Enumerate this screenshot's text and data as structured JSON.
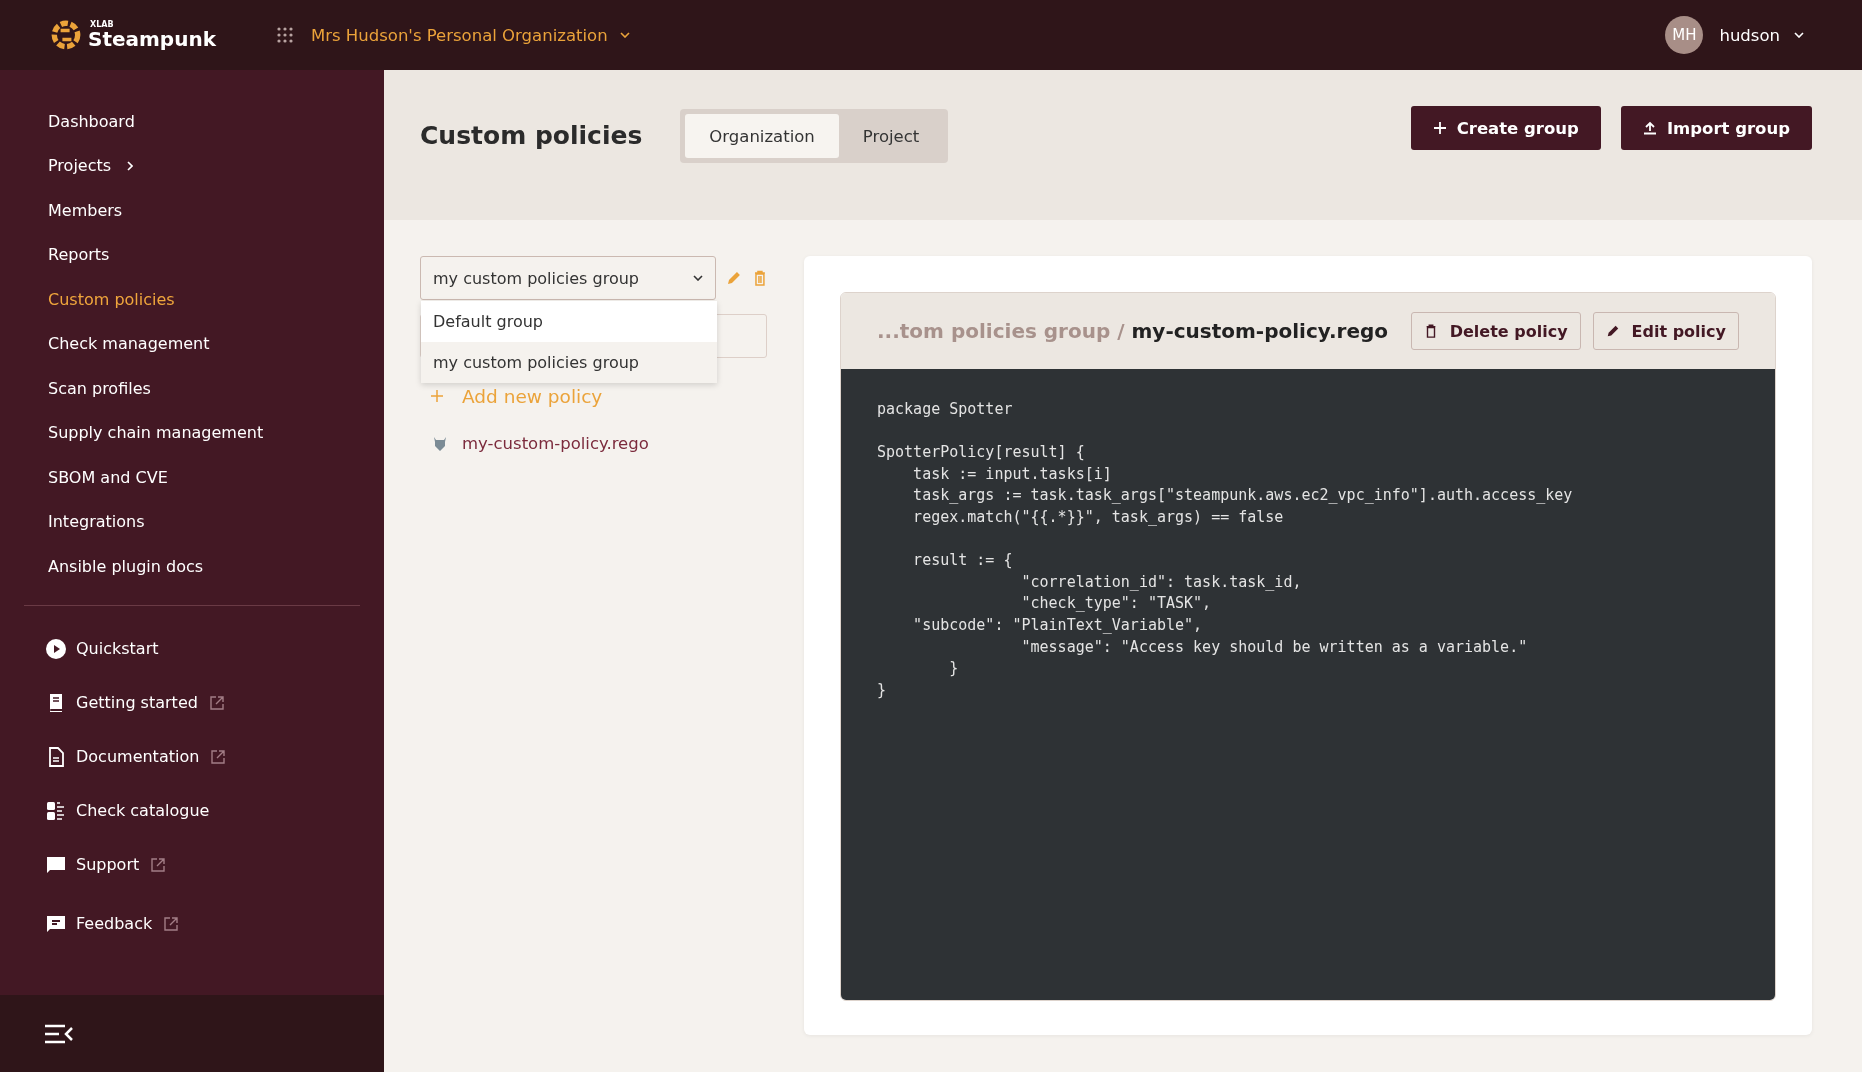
{
  "header": {
    "logo_small": "XLAB",
    "logo": "Steampunk",
    "organization": "Mrs Hudson's Personal Organization",
    "user": {
      "initials": "MH",
      "name": "hudson"
    }
  },
  "sidebar": {
    "items": [
      {
        "label": "Dashboard",
        "selected": false,
        "submenu": false
      },
      {
        "label": "Projects",
        "selected": false,
        "submenu": true
      },
      {
        "label": "Members",
        "selected": false,
        "submenu": false
      },
      {
        "label": "Reports",
        "selected": false,
        "submenu": false
      },
      {
        "label": "Custom policies",
        "selected": true,
        "submenu": false
      },
      {
        "label": "Check management",
        "selected": false,
        "submenu": false
      },
      {
        "label": "Scan profiles",
        "selected": false,
        "submenu": false
      },
      {
        "label": "Supply chain management",
        "selected": false,
        "submenu": false
      },
      {
        "label": "SBOM and CVE",
        "selected": false,
        "submenu": false
      },
      {
        "label": "Integrations",
        "selected": false,
        "submenu": false
      },
      {
        "label": "Ansible plugin docs",
        "selected": false,
        "submenu": false
      }
    ],
    "links": [
      {
        "label": "Quickstart",
        "kind": "play",
        "external": false
      },
      {
        "label": "Getting started",
        "kind": "book",
        "external": true
      },
      {
        "label": "Documentation",
        "kind": "document",
        "external": true
      },
      {
        "label": "Check catalogue",
        "kind": "catalogue",
        "external": false
      },
      {
        "label": "Support",
        "kind": "chat",
        "external": true
      },
      {
        "label": "Feedback",
        "kind": "feedback",
        "external": true
      }
    ]
  },
  "page": {
    "title": "Custom policies",
    "tabs": [
      {
        "label": "Organization",
        "selected": true
      },
      {
        "label": "Project",
        "selected": false
      }
    ],
    "buttons": [
      {
        "label": "Create group",
        "kind": "plus"
      },
      {
        "label": "Import group",
        "kind": "upload"
      }
    ]
  },
  "groups": {
    "select_value": "my custom policies group",
    "options": [
      {
        "label": "Default group",
        "selected": false
      },
      {
        "label": "my custom policies group",
        "selected": true
      }
    ],
    "add_policy": "Add new policy",
    "policies": [
      "my-custom-policy.rego"
    ]
  },
  "policy": {
    "group_path": "...tom policies group /",
    "file": "my-custom-policy.rego",
    "actions": [
      {
        "label": "Delete policy",
        "kind": "delete"
      },
      {
        "label": "Edit policy",
        "kind": "edit"
      }
    ],
    "code": "package Spotter\n\nSpotterPolicy[result] {\n    task := input.tasks[i]\n    task_args := task.task_args[\"steampunk.aws.ec2_vpc_info\"].auth.access_key\n    regex.match(\"{{.*}}\", task_args) == false\n\n    result := {\n                \"correlation_id\": task.task_id,\n                \"check_type\": \"TASK\",\n    \"subcode\": \"PlainText_Variable\",\n                \"message\": \"Access key should be written as a variable.\"\n        }\n}"
  }
}
